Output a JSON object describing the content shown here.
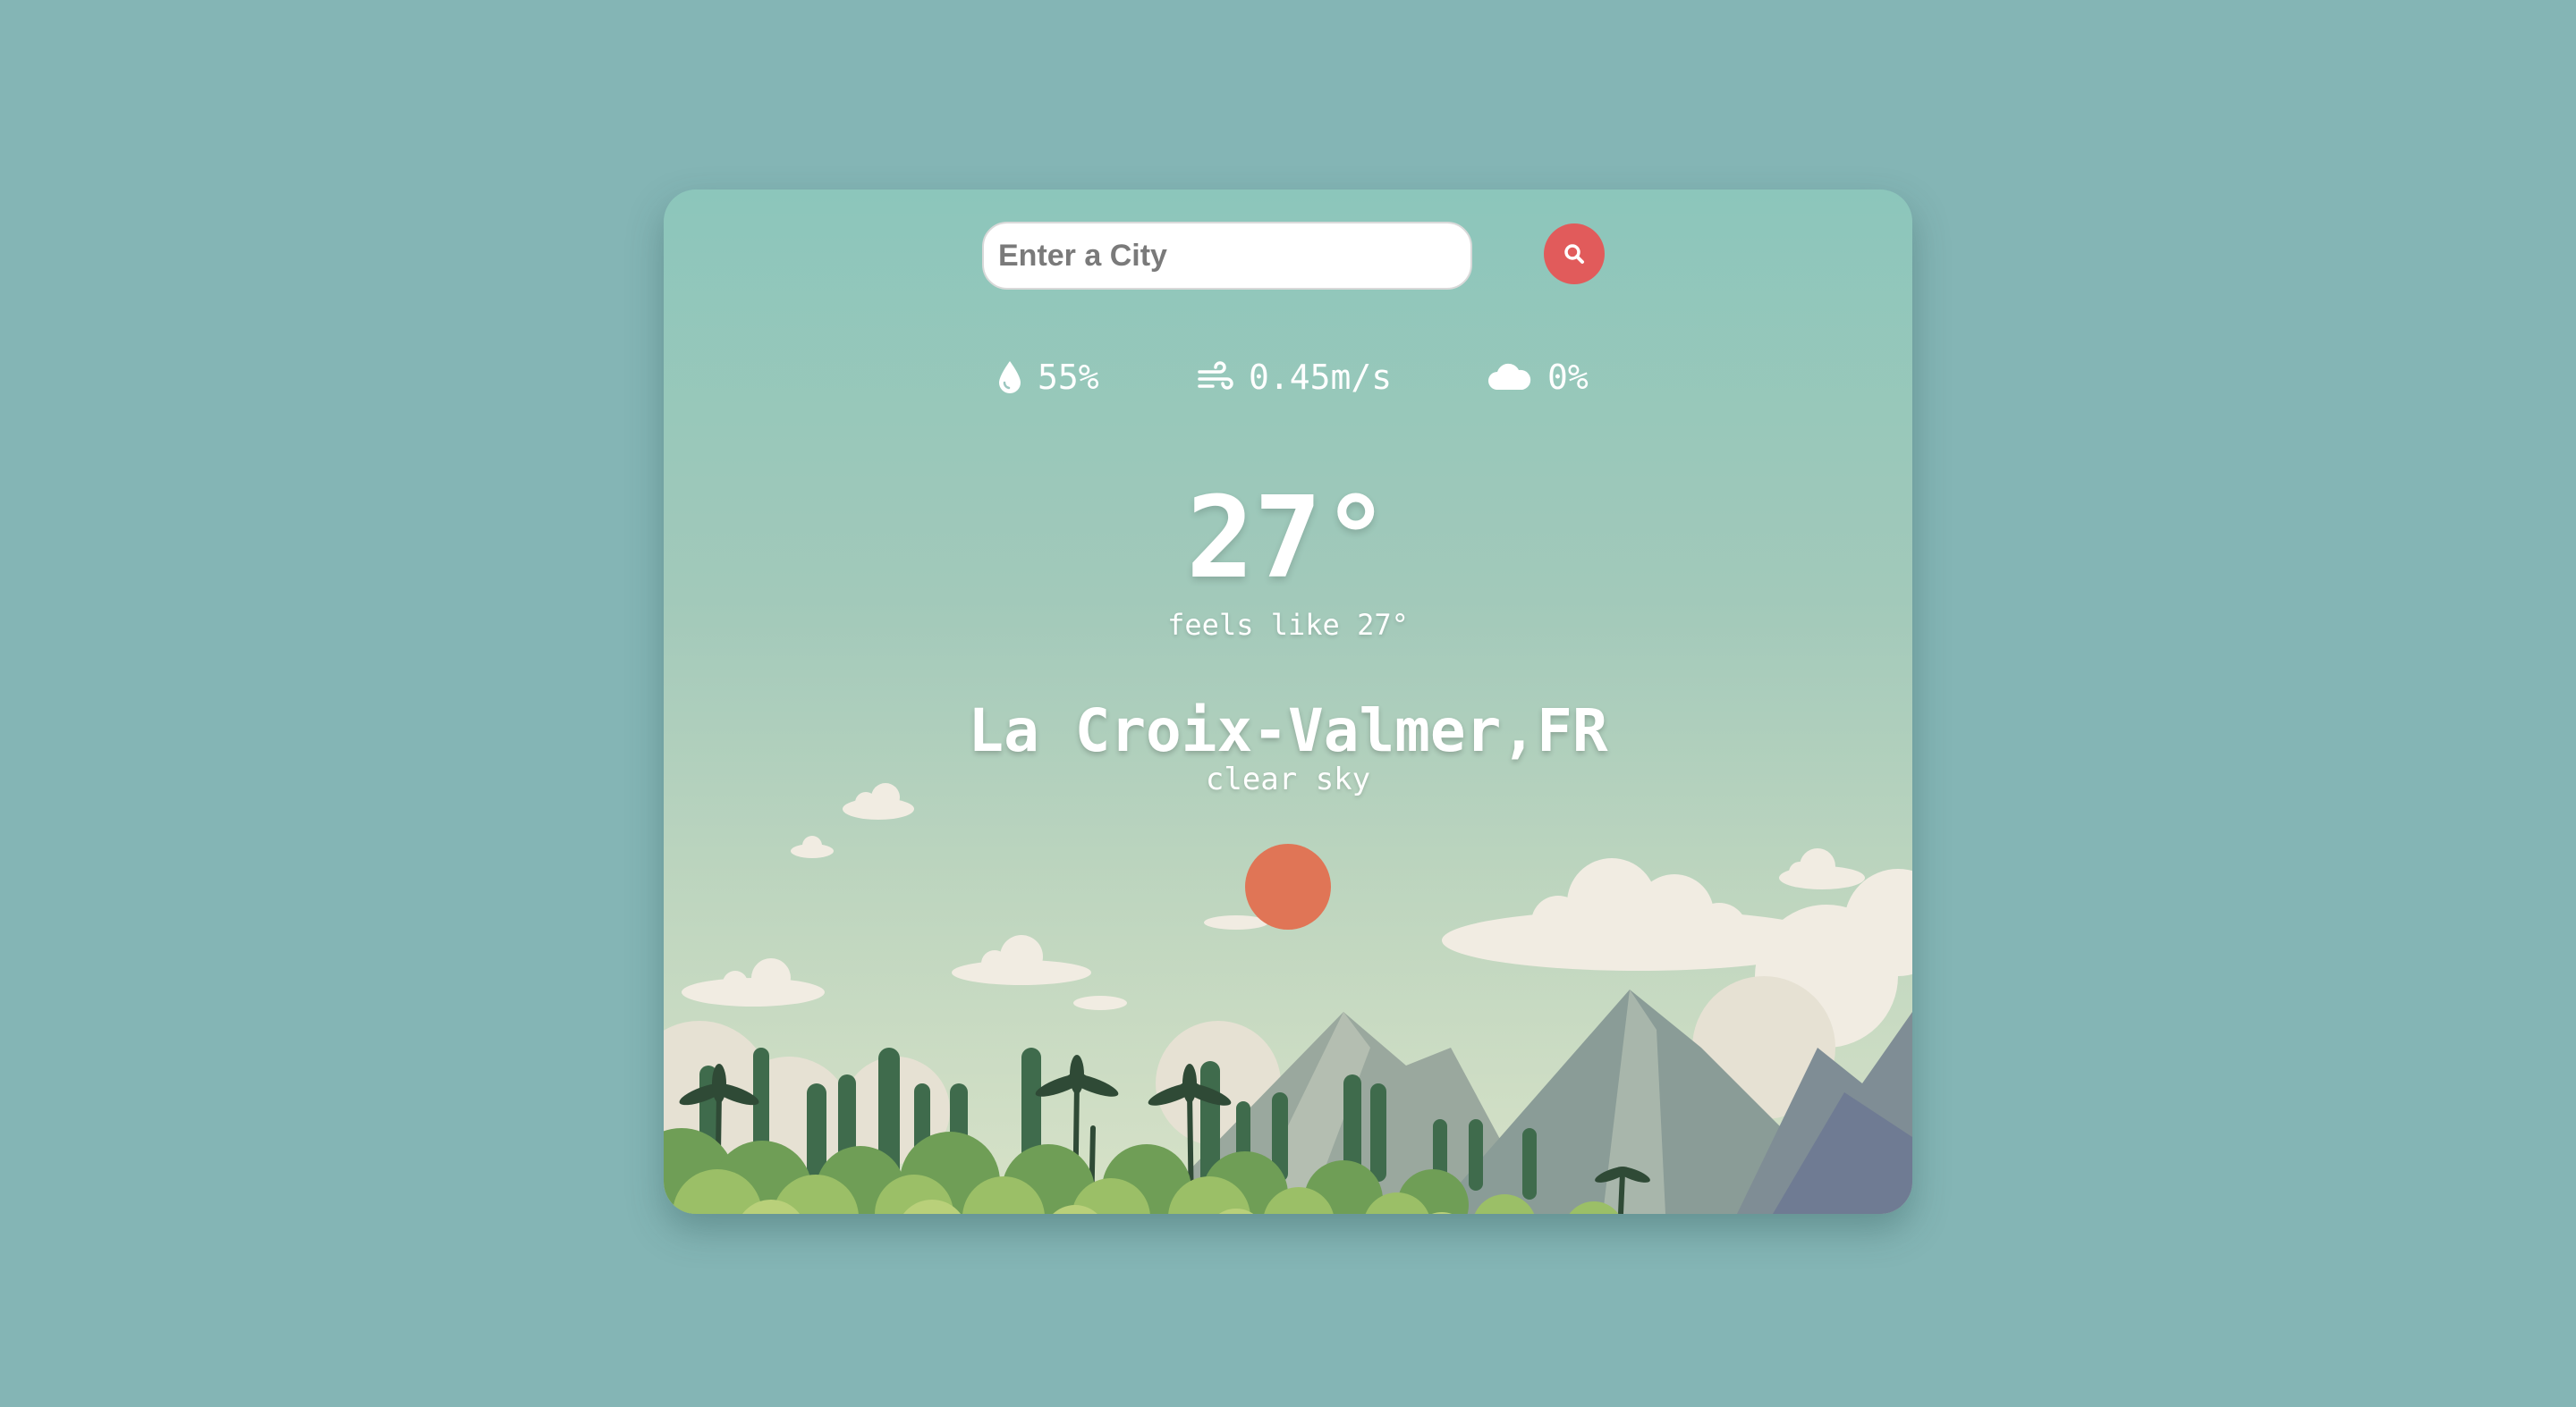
{
  "search": {
    "placeholder": "Enter a City",
    "value": "",
    "button_icon": "search-icon"
  },
  "stats": {
    "humidity": {
      "icon": "water-drop-icon",
      "value": "55%"
    },
    "wind": {
      "icon": "wind-icon",
      "value": "0.45m/s"
    },
    "clouds": {
      "icon": "cloud-icon",
      "value": "0%"
    }
  },
  "weather": {
    "temperature": "27°",
    "feels_like": "feels like 27°",
    "location": "La Croix-Valmer,FR",
    "description": "clear sky",
    "condition_icon": "sun-icon"
  },
  "colors": {
    "page_background": "#84b5b5",
    "accent": "#e15b5b",
    "sun": "#e07556",
    "text": "#ffffff"
  }
}
